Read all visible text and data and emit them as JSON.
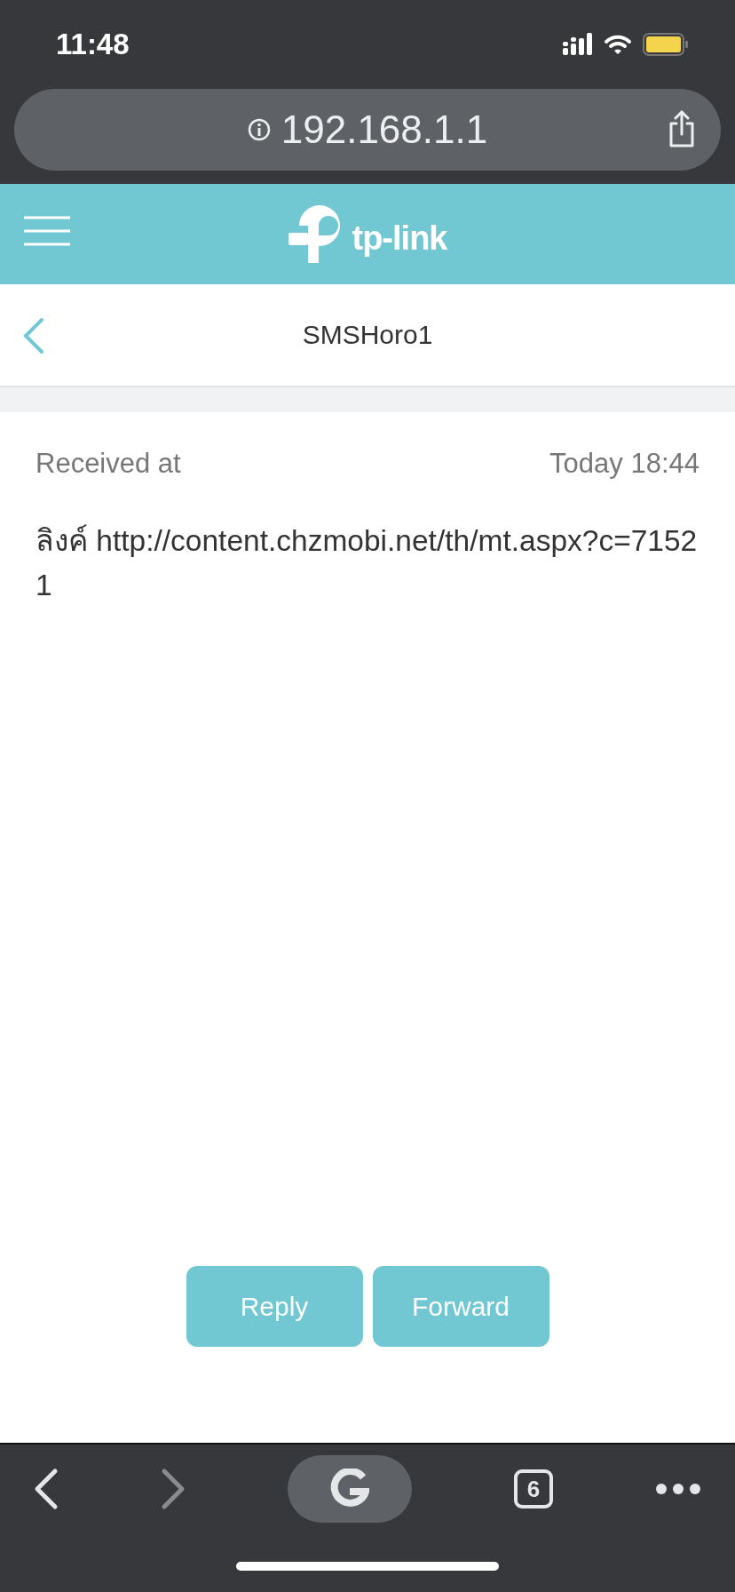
{
  "status_bar": {
    "time": "11:48"
  },
  "address_bar": {
    "url": "192.168.1.1"
  },
  "header": {
    "logo_text": "tp-link"
  },
  "page": {
    "title": "SMSHoro1"
  },
  "message": {
    "received_label": "Received at",
    "received_time": "Today 18:44",
    "body": "ลิงค์ http://content.chzmobi.net/th/mt.aspx?c=71521"
  },
  "buttons": [
    "Reply",
    "Forward"
  ],
  "toolbar": {
    "back_enabled": true,
    "forward_enabled": false,
    "tab_count": "6"
  }
}
